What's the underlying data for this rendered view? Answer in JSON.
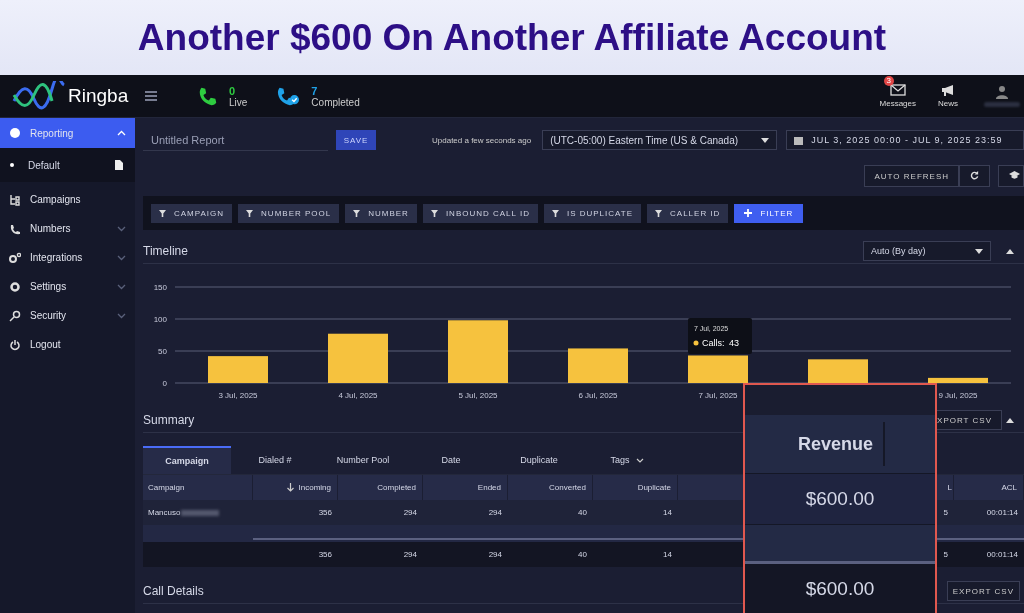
{
  "banner": {
    "title": "Another $600 On Another Affiliate Account"
  },
  "header": {
    "logo": "Ringba",
    "live": {
      "count": "0",
      "label": "Live"
    },
    "completed": {
      "count": "7",
      "label": "Completed"
    },
    "messages": {
      "label": "Messages",
      "badge": "3"
    },
    "news": {
      "label": "News"
    }
  },
  "sidebar": {
    "items": [
      {
        "label": "Reporting",
        "kind": "section",
        "selected": true,
        "expanded": true,
        "children": [
          {
            "label": "Default",
            "selected": false
          }
        ]
      },
      {
        "label": "Campaigns",
        "kind": "campaigns",
        "selected": false
      },
      {
        "label": "Numbers",
        "kind": "phone",
        "selected": false,
        "expanded": false
      },
      {
        "label": "Integrations",
        "kind": "gears",
        "selected": false,
        "expanded": false
      },
      {
        "label": "Settings",
        "kind": "gear",
        "selected": false,
        "expanded": false
      },
      {
        "label": "Security",
        "kind": "key",
        "selected": false,
        "expanded": false
      },
      {
        "label": "Logout",
        "kind": "power",
        "selected": false
      }
    ]
  },
  "report": {
    "name": "Untitled Report",
    "save": "SAVE",
    "updated": "Updated a few seconds ago",
    "timezone": "(UTC-05:00) Eastern Time (US & Canada)",
    "date_range": "JUL 3, 2025 00:00 - JUL 9, 2025 23:59",
    "auto_refresh": "AUTO REFRESH"
  },
  "filters": {
    "items": [
      "CAMPAIGN",
      "NUMBER POOL",
      "NUMBER",
      "INBOUND CALL ID",
      "IS DUPLICATE",
      "CALLER ID"
    ],
    "add": "FILTER"
  },
  "timeline": {
    "title": "Timeline",
    "granularity": "Auto (By day)",
    "tooltip": {
      "title": "7 Jul, 2025",
      "label": "Calls:",
      "value": "43"
    },
    "chart_data": {
      "type": "bar",
      "categories": [
        "3 Jul, 2025",
        "4 Jul, 2025",
        "5 Jul, 2025",
        "6 Jul, 2025",
        "7 Jul, 2025",
        null,
        "9 Jul, 2025"
      ],
      "series": [
        {
          "color": "#f6c23e",
          "values": [
            42,
            77,
            98,
            54,
            43,
            37,
            8
          ]
        }
      ],
      "ylim": [
        0,
        150
      ],
      "yticks": [
        0,
        50,
        100,
        150
      ]
    }
  },
  "summary": {
    "title": "Summary",
    "export": "XPORT CSV",
    "tabs": [
      {
        "label": "Campaign",
        "selected": true
      },
      {
        "label": "Dialed #",
        "selected": false
      },
      {
        "label": "Number Pool",
        "selected": false
      },
      {
        "label": "Date",
        "selected": false
      },
      {
        "label": "Duplicate",
        "selected": false
      },
      {
        "label": "Tags",
        "selected": false,
        "kind": "dropdown"
      }
    ],
    "columns": [
      "Campaign",
      "Incoming",
      "Completed",
      "Ended",
      "Converted",
      "Duplicate",
      "L",
      "ACL"
    ],
    "rows": [
      {
        "cells": [
          "Mancuso",
          "356",
          "294",
          "294",
          "40",
          "14",
          "5",
          "00:01:14"
        ],
        "blurred": true
      }
    ],
    "totals": [
      "356",
      "294",
      "294",
      "40",
      "14",
      "5",
      "00:01:14"
    ]
  },
  "call_details": {
    "title": "Call Details",
    "export": "EXPORT CSV"
  },
  "magnifier": {
    "column": "Revenue",
    "value": "$600.00",
    "total": "$600.00"
  }
}
